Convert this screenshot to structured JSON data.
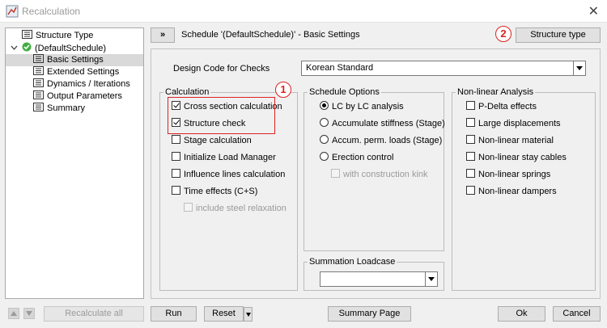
{
  "window": {
    "title": "Recalculation",
    "close_symbol": "✕"
  },
  "tree": {
    "items": [
      {
        "label": "Structure Type"
      },
      {
        "label": "(DefaultSchedule)"
      },
      {
        "label": "Basic Settings"
      },
      {
        "label": "Extended Settings"
      },
      {
        "label": "Dynamics / Iterations"
      },
      {
        "label": "Output Parameters"
      },
      {
        "label": "Summary"
      }
    ]
  },
  "header": {
    "expand_button": "»",
    "title": "Schedule '(DefaultSchedule)' - Basic Settings",
    "structure_type_button": "Structure type"
  },
  "annotations": {
    "badge1": "1",
    "badge2": "2",
    "color": "#dd2222"
  },
  "design_code": {
    "label": "Design Code for Checks",
    "value": "Korean Standard"
  },
  "calculation": {
    "legend": "Calculation",
    "items": [
      {
        "label": "Cross section calculation",
        "checked": true
      },
      {
        "label": "Structure check",
        "checked": true
      },
      {
        "label": "Stage calculation",
        "checked": false
      },
      {
        "label": "Initialize Load Manager",
        "checked": false
      },
      {
        "label": "Influence lines calculation",
        "checked": false
      },
      {
        "label": "Time effects (C+S)",
        "checked": false
      },
      {
        "label": "include steel relaxation",
        "checked": false,
        "disabled": true
      }
    ]
  },
  "schedule_options": {
    "legend": "Schedule Options",
    "items": [
      {
        "label": "LC by LC analysis",
        "selected": true
      },
      {
        "label": "Accumulate stiffness (Stage)",
        "selected": false
      },
      {
        "label": "Accum. perm. loads (Stage)",
        "selected": false
      },
      {
        "label": "Erection control",
        "selected": false
      }
    ],
    "sub_item": {
      "label": "with construction kink",
      "checked": false,
      "disabled": true
    }
  },
  "summation": {
    "legend": "Summation Loadcase",
    "value": ""
  },
  "nonlinear": {
    "legend": "Non-linear Analysis",
    "items": [
      {
        "label": "P-Delta effects",
        "checked": false
      },
      {
        "label": "Large displacements",
        "checked": false
      },
      {
        "label": "Non-linear material",
        "checked": false
      },
      {
        "label": "Non-linear stay cables",
        "checked": false
      },
      {
        "label": "Non-linear springs",
        "checked": false
      },
      {
        "label": "Non-linear dampers",
        "checked": false
      }
    ]
  },
  "footer": {
    "recalculate_all": "Recalculate all",
    "run": "Run",
    "reset": "Reset",
    "summary_page": "Summary Page",
    "ok": "Ok",
    "cancel": "Cancel"
  }
}
